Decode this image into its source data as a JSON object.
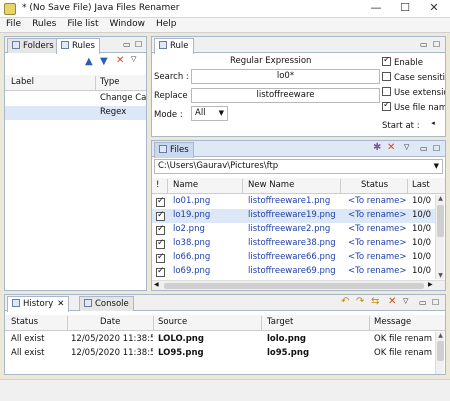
{
  "window": {
    "title": "* (No Save File) Java Files Renamer",
    "minimize": "—",
    "maximize": "☐",
    "close": "✕"
  },
  "menu": {
    "items": [
      "File",
      "Rules",
      "File list",
      "Window",
      "Help"
    ]
  },
  "left_panel": {
    "tabs": [
      "Folders",
      "Rules"
    ],
    "columns": [
      "Label",
      "Type"
    ],
    "rows": [
      {
        "label": "",
        "type": "Change Cas"
      },
      {
        "label": "",
        "type": "Regex"
      }
    ]
  },
  "rule_panel": {
    "tab": "Rule",
    "heading": "Regular Expression",
    "search_label": "Search :",
    "search_value": "lo0*",
    "replace_label": "Replace :",
    "replace_value": "listoffreeware",
    "mode_label": "Mode :",
    "mode_value": "All",
    "options": [
      {
        "label": "Enable",
        "checked": true
      },
      {
        "label": "Case sensitiv",
        "checked": false
      },
      {
        "label": "Use extensio",
        "checked": false
      },
      {
        "label": "Use file nam",
        "checked": true
      }
    ],
    "start_at_label": "Start at :",
    "start_at_value": ""
  },
  "files_panel": {
    "tab": "Files",
    "path": "C:\\Users\\Gaurav\\Pictures\\ftp",
    "columns": [
      "!",
      "Name",
      "New Name",
      "Status",
      "Last"
    ],
    "rows": [
      {
        "name": "lo01.png",
        "new_name": "listoffreeware1.png",
        "status": "<To rename>",
        "last": "10/0"
      },
      {
        "name": "lo19.png",
        "new_name": "listoffreeware19.png",
        "status": "<To rename>",
        "last": "10/0"
      },
      {
        "name": "lo2.png",
        "new_name": "listoffreeware2.png",
        "status": "<To rename>",
        "last": "10/0"
      },
      {
        "name": "lo38.png",
        "new_name": "listoffreeware38.png",
        "status": "<To rename>",
        "last": "10/0"
      },
      {
        "name": "lo66.png",
        "new_name": "listoffreeware66.png",
        "status": "<To rename>",
        "last": "10/0"
      },
      {
        "name": "lo69.png",
        "new_name": "listoffreeware69.png",
        "status": "<To rename>",
        "last": "10/0"
      }
    ]
  },
  "history_panel": {
    "tabs": [
      "History",
      "Console"
    ],
    "columns": [
      "Status",
      "Date",
      "Source",
      "Target",
      "Message"
    ],
    "rows": [
      {
        "status": "All exist",
        "date": "12/05/2020 11:38:56",
        "source": "LOLO.png",
        "target": "lolo.png",
        "message": "OK file renam"
      },
      {
        "status": "All exist",
        "date": "12/05/2020 11:38:56",
        "source": "LO95.png",
        "target": "lo95.png",
        "message": "OK file renam"
      }
    ]
  },
  "colors": {
    "link": "#1f3fa8",
    "selected_row": "#dce7f7",
    "panel_border": "#a9b7c9"
  }
}
